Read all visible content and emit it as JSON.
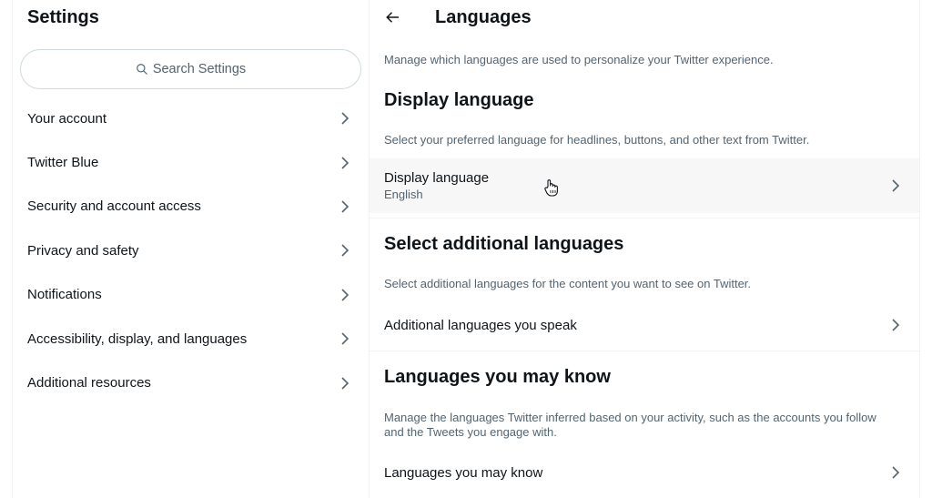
{
  "settings": {
    "title": "Settings",
    "search_placeholder": "Search Settings",
    "menu": [
      {
        "label": "Your account"
      },
      {
        "label": "Twitter Blue"
      },
      {
        "label": "Security and account access"
      },
      {
        "label": "Privacy and safety"
      },
      {
        "label": "Notifications"
      },
      {
        "label": "Accessibility, display, and languages"
      },
      {
        "label": "Additional resources"
      }
    ]
  },
  "languages": {
    "title": "Languages",
    "intro": "Manage which languages are used to personalize your Twitter experience.",
    "display": {
      "heading": "Display language",
      "description": "Select your preferred language for headlines, buttons, and other text from Twitter.",
      "row_label": "Display language",
      "row_value": "English"
    },
    "additional": {
      "heading": "Select additional languages",
      "description": "Select additional languages for the content you want to see on Twitter.",
      "row_label": "Additional languages you speak"
    },
    "may_know": {
      "heading": "Languages you may know",
      "description": "Manage the languages Twitter inferred based on your activity, such as the accounts you follow and the Tweets you engage with.",
      "row_label": "Languages you may know"
    }
  },
  "icons": {
    "search": "search-icon",
    "back": "arrow-left-icon",
    "chevron": "chevron-right-icon",
    "cursor": "hand-pointer-icon"
  },
  "colors": {
    "text": "#0f1419",
    "secondary": "#536471",
    "border": "#cfd9de",
    "hover": "#f7f7f7"
  }
}
